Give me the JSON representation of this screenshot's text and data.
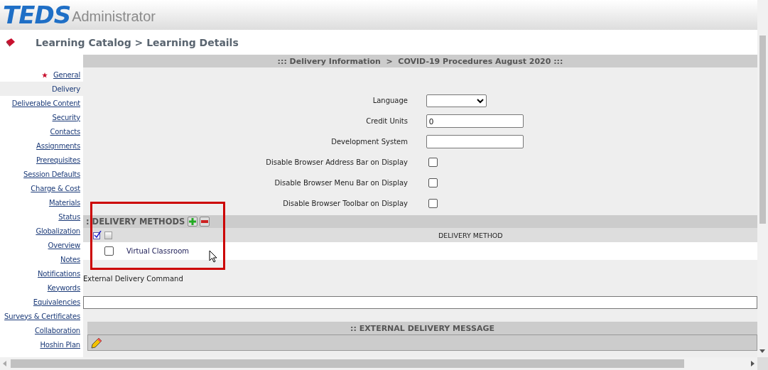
{
  "header": {
    "logo": "TEDS",
    "product": "Administrator"
  },
  "breadcrumb": "Learning Catalog > Learning Details",
  "section_title": "::: Delivery Information  >  COVID-19 Procedures August 2020 :::",
  "sidebar": {
    "items": [
      {
        "label": "General",
        "selected": false,
        "required": true
      },
      {
        "label": "Delivery",
        "selected": true,
        "required": false
      },
      {
        "label": "Deliverable Content",
        "selected": false,
        "required": false
      },
      {
        "label": "Security",
        "selected": false,
        "required": false
      },
      {
        "label": "Contacts",
        "selected": false,
        "required": false
      },
      {
        "label": "Assignments",
        "selected": false,
        "required": false
      },
      {
        "label": "Prerequisites",
        "selected": false,
        "required": false
      },
      {
        "label": "Session Defaults",
        "selected": false,
        "required": false
      },
      {
        "label": "Charge & Cost",
        "selected": false,
        "required": false
      },
      {
        "label": "Materials",
        "selected": false,
        "required": false
      },
      {
        "label": "Status",
        "selected": false,
        "required": false
      },
      {
        "label": "Globalization",
        "selected": false,
        "required": false
      },
      {
        "label": "Overview",
        "selected": false,
        "required": false
      },
      {
        "label": "Notes",
        "selected": false,
        "required": false
      },
      {
        "label": "Notifications",
        "selected": false,
        "required": false
      },
      {
        "label": "Keywords",
        "selected": false,
        "required": false
      },
      {
        "label": "Equivalencies",
        "selected": false,
        "required": false
      },
      {
        "label": "Surveys & Certificates",
        "selected": false,
        "required": false
      },
      {
        "label": "Collaboration",
        "selected": false,
        "required": false
      },
      {
        "label": "Hoshin Plan",
        "selected": false,
        "required": false
      }
    ]
  },
  "form": [
    {
      "kind": "select",
      "label": "Language"
    },
    {
      "kind": "text",
      "label": "Credit Units",
      "value": "0"
    },
    {
      "kind": "text",
      "label": "Development System"
    },
    {
      "kind": "checkbox",
      "label": "Disable Browser Address Bar on Display",
      "checked": false
    },
    {
      "kind": "checkbox",
      "label": "Disable Browser Menu Bar on Display",
      "checked": false
    },
    {
      "kind": "checkbox",
      "label": "Disable Browser Toolbar on Display",
      "checked": false
    }
  ],
  "delivery_methods": {
    "title": ": DELIVERY METHODS",
    "column": "DELIVERY METHOD",
    "rows": [
      {
        "name": "Virtual Classroom",
        "checked": false
      }
    ]
  },
  "external_command": {
    "label": "External Delivery Command"
  },
  "external_message": {
    "title": ":: EXTERNAL DELIVERY MESSAGE"
  }
}
